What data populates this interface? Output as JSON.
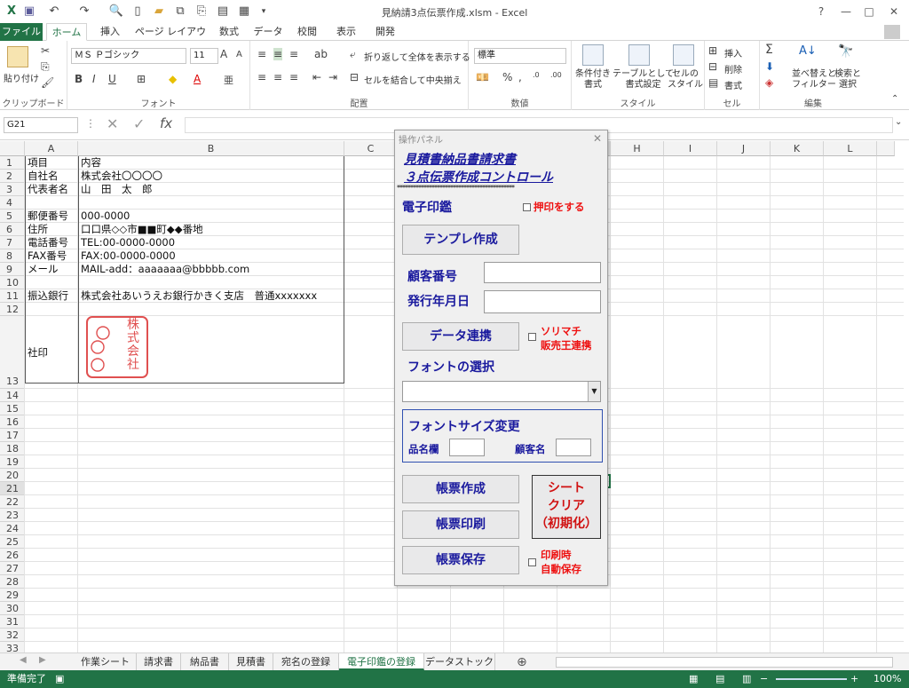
{
  "window": {
    "title": "見納請3点伝票作成.xlsm - Excel",
    "qa_icons": [
      "excel-logo-icon",
      "save-icon",
      "undo-icon",
      "redo-icon",
      "print-preview-icon",
      "new-file-icon",
      "open-folder-icon",
      "share-icon",
      "copy-icon",
      "form-icon",
      "table-icon",
      "customize-icon"
    ],
    "help": "?",
    "min": "—",
    "max": "□",
    "close": "✕"
  },
  "tabs": [
    "ファイル",
    "ホーム",
    "挿入",
    "ページ レイアウト",
    "数式",
    "データ",
    "校閲",
    "表示",
    "開発"
  ],
  "ribbon": {
    "clipboard": {
      "paste": "貼り付け",
      "label": "クリップボード"
    },
    "font": {
      "name": "ＭＳ Ｐゴシック",
      "size": "11",
      "label": "フォント",
      "bold": "B",
      "italic": "I",
      "underline": "U",
      "grow": "A",
      "shrink": "A",
      "color_a": "A",
      "phonetic": "亜"
    },
    "align": {
      "wrap": "折り返して全体を表示する",
      "merge": "セルを結合して中央揃え",
      "label": "配置"
    },
    "number": {
      "format": "標準",
      "label": "数値",
      "percent": "%",
      "comma": ","
    },
    "style": {
      "cond": "条件付き\n書式",
      "table": "テーブルとして\n書式設定",
      "cell": "セルの\nスタイル",
      "label": "スタイル"
    },
    "cells": {
      "insert": "挿入",
      "delete": "削除",
      "format": "書式",
      "label": "セル"
    },
    "edit": {
      "sort": "並べ替えと\nフィルター",
      "find": "検索と\n選択",
      "label": "編集",
      "sum": "Σ"
    }
  },
  "formula": {
    "namebox": "G21",
    "x": "✕",
    "check": "✓",
    "fx": "fx",
    "value": ""
  },
  "columns": [
    "A",
    "B",
    "C",
    "D",
    "E",
    "F",
    "G",
    "H",
    "I",
    "J",
    "K",
    "L"
  ],
  "rows": [
    "1",
    "2",
    "3",
    "4",
    "5",
    "6",
    "7",
    "8",
    "9",
    "10",
    "11",
    "12",
    "13",
    "14",
    "15",
    "16",
    "17",
    "18",
    "19",
    "20",
    "21",
    "22",
    "23",
    "24",
    "25",
    "26",
    "27",
    "28",
    "29",
    "30",
    "31",
    "32",
    "33"
  ],
  "cells": [
    {
      "a": "項目",
      "b": "内容"
    },
    {
      "a": "自社名",
      "b": "株式会社〇〇〇〇"
    },
    {
      "a": "代表者名",
      "b": "山　田　太　郎"
    },
    {
      "a": "",
      "b": ""
    },
    {
      "a": "郵便番号",
      "b": "000-0000"
    },
    {
      "a": "住所",
      "b": "口口県◇◇市■■町◆◆番地"
    },
    {
      "a": "電話番号",
      "b": "TEL:00-0000-0000"
    },
    {
      "a": "FAX番号",
      "b": "FAX:00-0000-0000"
    },
    {
      "a": "メール",
      "b": "MAIL-add：aaaaaaa@bbbbb.com"
    },
    {
      "a": "",
      "b": ""
    },
    {
      "a": "振込銀行",
      "b": "株式会社あいうえお銀行かきく支店　普通xxxxxxx"
    },
    {
      "a": "",
      "b": ""
    },
    {
      "a": "社印",
      "b": ""
    }
  ],
  "stamp": {
    "chars": [
      "株",
      "式",
      "会",
      "社"
    ],
    "color": "#e05050"
  },
  "panel": {
    "title": "操作パネル",
    "heading1": "見積書納品書請求書",
    "heading2": "３点伝票作成コントロール",
    "stars": "********************************************",
    "seal_label": "電子印鑑",
    "seal_check": "押印をする",
    "template_btn": "テンプレ作成",
    "customer_no": "顧客番号",
    "issue_date": "発行年月日",
    "data_btn": "データ連携",
    "sorimachi1": "ソリマチ",
    "sorimachi2": "販売王連携",
    "font_select": "フォントの選択",
    "font_dropdown": "",
    "fontsize_title": "フォントサイズ変更",
    "item_col": "品名欄",
    "cust_name": "顧客名",
    "create_btn": "帳票作成",
    "print_btn": "帳票印刷",
    "save_btn": "帳票保存",
    "clear1": "シート",
    "clear2": "クリア",
    "clear3": "（初期化）",
    "autosave1": "印刷時",
    "autosave2": "自動保存"
  },
  "sheets": [
    "作業シート",
    "請求書",
    "納品書",
    "見積書",
    "宛名の登録",
    "電子印鑑の登録",
    "データストック"
  ],
  "active_sheet": "電子印鑑の登録",
  "status": {
    "ready": "準備完了",
    "zoom": "100%"
  },
  "colors": {
    "excel_green": "#217346",
    "button_text": "#1a1a9e",
    "red_label": "#e11111"
  }
}
